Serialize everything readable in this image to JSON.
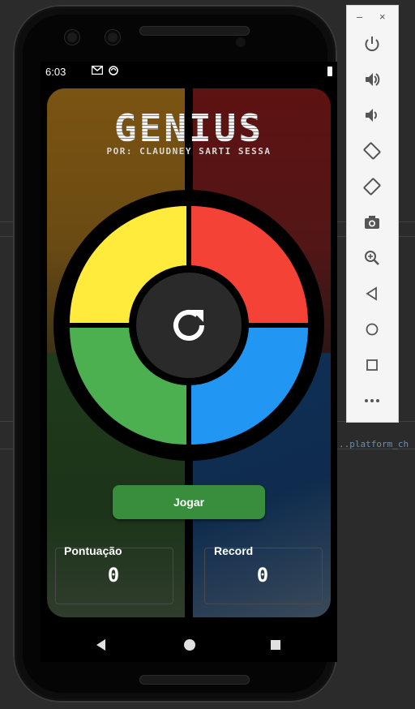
{
  "status_bar": {
    "time": "6:03",
    "icons": [
      "gmail-icon",
      "sync-icon",
      "battery-icon"
    ]
  },
  "app": {
    "title": "GENIUS",
    "subtitle": "POR: CLAUDNEY SARTI SESSA",
    "play_button": "Jogar",
    "score": {
      "label": "Pontuação",
      "value": "0"
    },
    "record": {
      "label": "Record",
      "value": "0"
    },
    "pads": [
      "yellow-pad",
      "red-pad",
      "green-pad",
      "blue-pad"
    ],
    "center_icon": "refresh-icon",
    "colors": {
      "yellow": "#ffeb3b",
      "red": "#f44336",
      "green": "#4caf50",
      "blue": "#2196f3",
      "play_button": "#388e3c",
      "center": "#2a2a2a"
    }
  },
  "nav_bar": {
    "icons": [
      "back-icon",
      "home-icon",
      "recents-icon"
    ]
  },
  "emulator_panel": {
    "window_buttons": [
      "–",
      "×"
    ],
    "icons": [
      "power-icon",
      "volume-up-icon",
      "volume-down-icon",
      "rotate-left-icon",
      "rotate-right-icon",
      "camera-icon",
      "zoom-icon",
      "back-icon",
      "home-icon",
      "overview-icon",
      "more-icon"
    ]
  },
  "ide": {
    "code_fragment": "..platform_ch"
  }
}
